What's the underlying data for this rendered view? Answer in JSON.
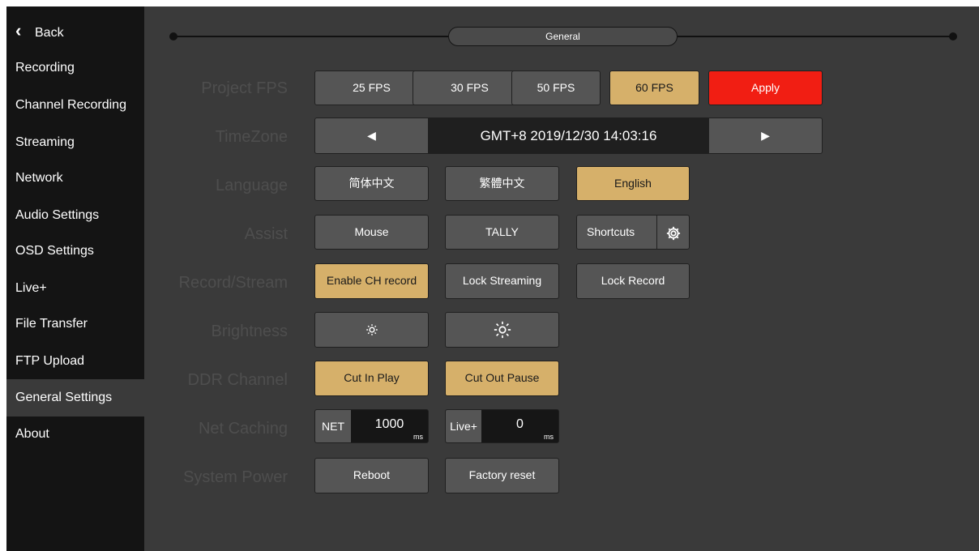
{
  "sidebar": {
    "back_label": "Back",
    "items": [
      {
        "label": "Recording"
      },
      {
        "label": "Channel Recording"
      },
      {
        "label": "Streaming"
      },
      {
        "label": "Network"
      },
      {
        "label": "Audio Settings"
      },
      {
        "label": "OSD Settings"
      },
      {
        "label": "Live+"
      },
      {
        "label": "File Transfer"
      },
      {
        "label": "FTP Upload"
      },
      {
        "label": "General Settings",
        "active": true
      },
      {
        "label": "About"
      }
    ]
  },
  "timeline": {
    "title": "General"
  },
  "rows": {
    "project_fps": {
      "label": "Project FPS",
      "options": [
        "25 FPS",
        "30 FPS",
        "50 FPS",
        "60 FPS"
      ],
      "selected": "60 FPS",
      "apply_label": "Apply"
    },
    "timezone": {
      "label": "TimeZone",
      "value": "GMT+8 2019/12/30 14:03:16",
      "prev_icon": "triangle-left-icon",
      "next_icon": "triangle-right-icon"
    },
    "language": {
      "label": "Language",
      "options": [
        "简体中文",
        "繁體中文",
        "English"
      ],
      "selected": "English"
    },
    "assist": {
      "label": "Assist",
      "mouse": "Mouse",
      "tally": "TALLY",
      "shortcuts": "Shortcuts",
      "shortcuts_icon": "gear-icon"
    },
    "record_stream": {
      "label": "Record/Stream",
      "enable_ch_record": "Enable CH record",
      "enable_ch_record_on": true,
      "lock_streaming": "Lock Streaming",
      "lock_record": "Lock Record"
    },
    "brightness": {
      "label": "Brightness",
      "decrease_icon": "sun-small-icon",
      "increase_icon": "sun-large-icon"
    },
    "ddr_channel": {
      "label": "DDR Channel",
      "cut_in": "Cut In Play",
      "cut_out": "Cut Out Pause"
    },
    "net_caching": {
      "label": "Net Caching",
      "net_tag": "NET",
      "net_value": "1000",
      "net_unit": "ms",
      "live_tag": "Live+",
      "live_value": "0",
      "live_unit": "ms"
    },
    "system_power": {
      "label": "System Power",
      "reboot": "Reboot",
      "factory_reset": "Factory reset"
    }
  },
  "colors": {
    "accent": "#d6b06a",
    "apply": "#f11e13",
    "button": "#555555",
    "background": "#3a3a3a",
    "sidebar": "#141414"
  }
}
